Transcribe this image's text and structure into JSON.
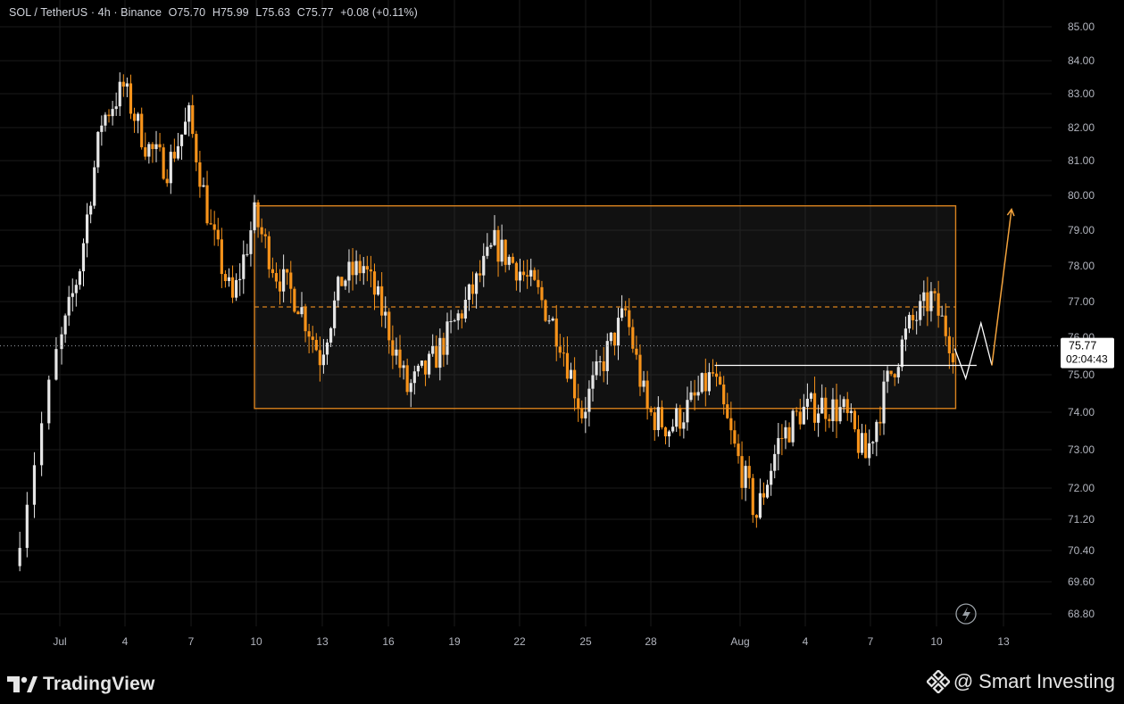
{
  "header": {
    "symbol": "SOL / TetherUS · 4h · Binance",
    "open": "O75.70",
    "high": "H75.99",
    "low": "L75.63",
    "close": "C75.77",
    "change": "+0.08 (+0.11%)"
  },
  "price_tag": {
    "price": "75.77",
    "countdown": "02:04:43"
  },
  "footer": {
    "brand": "TradingView",
    "credit_at": "@",
    "credit_name": "Smart Investing"
  },
  "colors": {
    "up": "#e6e6e6",
    "down": "#f7931a",
    "box": "#d9821e",
    "grid": "#1a1a1a",
    "axis_text": "#b2b5be"
  },
  "icons": {
    "replay": "lightning-icon",
    "tv_logo": "tradingview-logo-icon",
    "binance": "binance-diamond-icon"
  },
  "chart_data": {
    "type": "candlestick",
    "title": "",
    "x_tick_labels": [
      "Jul",
      "4",
      "7",
      "10",
      "13",
      "16",
      "19",
      "22",
      "25",
      "28",
      "Aug",
      "4",
      "7",
      "10",
      "13"
    ],
    "y_tick_labels": [
      "85.00",
      "84.00",
      "83.00",
      "82.00",
      "81.00",
      "80.00",
      "79.00",
      "78.00",
      "77.00",
      "76.00",
      "75.00",
      "74.00",
      "73.00",
      "72.00",
      "71.20",
      "70.40",
      "69.60",
      "68.80"
    ],
    "ylim": [
      68.5,
      85.3
    ],
    "last_price": 75.77,
    "key_points": [
      {
        "x": "Jun 29",
        "y": 70.0
      },
      {
        "x": "Jul 1",
        "y": 75.5
      },
      {
        "x": "Jul 2",
        "y": 78.0
      },
      {
        "x": "Jul 3",
        "y": 82.2
      },
      {
        "x": "Jul 4",
        "y": 83.2
      },
      {
        "x": "Jul 5",
        "y": 81.5
      },
      {
        "x": "Jul 6",
        "y": 80.8
      },
      {
        "x": "Jul 7",
        "y": 82.3
      },
      {
        "x": "Jul 8",
        "y": 79.0
      },
      {
        "x": "Jul 9",
        "y": 77.0
      },
      {
        "x": "Jul 10",
        "y": 79.4
      },
      {
        "x": "Jul 11",
        "y": 77.8
      },
      {
        "x": "Jul 12",
        "y": 77.0
      },
      {
        "x": "Jul 13",
        "y": 75.5
      },
      {
        "x": "Jul 14",
        "y": 77.6
      },
      {
        "x": "Jul 15",
        "y": 78.0
      },
      {
        "x": "Jul 16",
        "y": 76.5
      },
      {
        "x": "Jul 17",
        "y": 74.6
      },
      {
        "x": "Jul 18",
        "y": 75.2
      },
      {
        "x": "Jul 19",
        "y": 76.2
      },
      {
        "x": "Jul 20",
        "y": 77.3
      },
      {
        "x": "Jul 21",
        "y": 78.6
      },
      {
        "x": "Jul 22",
        "y": 78.0
      },
      {
        "x": "Jul 23",
        "y": 77.2
      },
      {
        "x": "Jul 24",
        "y": 76.0
      },
      {
        "x": "Jul 25",
        "y": 74.0
      },
      {
        "x": "Jul 26",
        "y": 75.4
      },
      {
        "x": "Jul 27",
        "y": 76.7
      },
      {
        "x": "Jul 28",
        "y": 74.0
      },
      {
        "x": "Jul 29",
        "y": 73.6
      },
      {
        "x": "Jul 30",
        "y": 74.2
      },
      {
        "x": "Jul 31",
        "y": 75.0
      },
      {
        "x": "Aug 1",
        "y": 73.0
      },
      {
        "x": "Aug 2",
        "y": 71.3
      },
      {
        "x": "Aug 3",
        "y": 73.2
      },
      {
        "x": "Aug 4",
        "y": 74.0
      },
      {
        "x": "Aug 5",
        "y": 74.2
      },
      {
        "x": "Aug 6",
        "y": 74.0
      },
      {
        "x": "Aug 7",
        "y": 72.8
      },
      {
        "x": "Aug 8",
        "y": 74.8
      },
      {
        "x": "Aug 9",
        "y": 76.3
      },
      {
        "x": "Aug 10",
        "y": 77.1
      },
      {
        "x": "Aug 11",
        "y": 75.77
      }
    ],
    "range_box": {
      "x_start": "Jul 10",
      "x_end": "Aug 11",
      "top": 79.7,
      "bottom": 74.1,
      "mid": 76.85
    },
    "support_line": {
      "x_start": "Jul 31",
      "x_end": "Aug 12",
      "y": 75.25
    },
    "projection": [
      {
        "x": "Aug 11",
        "y": 75.7
      },
      {
        "x": "Aug 11.5",
        "y": 74.9
      },
      {
        "x": "Aug 12.2",
        "y": 76.4
      },
      {
        "x": "Aug 12.7",
        "y": 75.25
      },
      {
        "x": "Aug 13.6",
        "y": 79.6
      }
    ]
  }
}
